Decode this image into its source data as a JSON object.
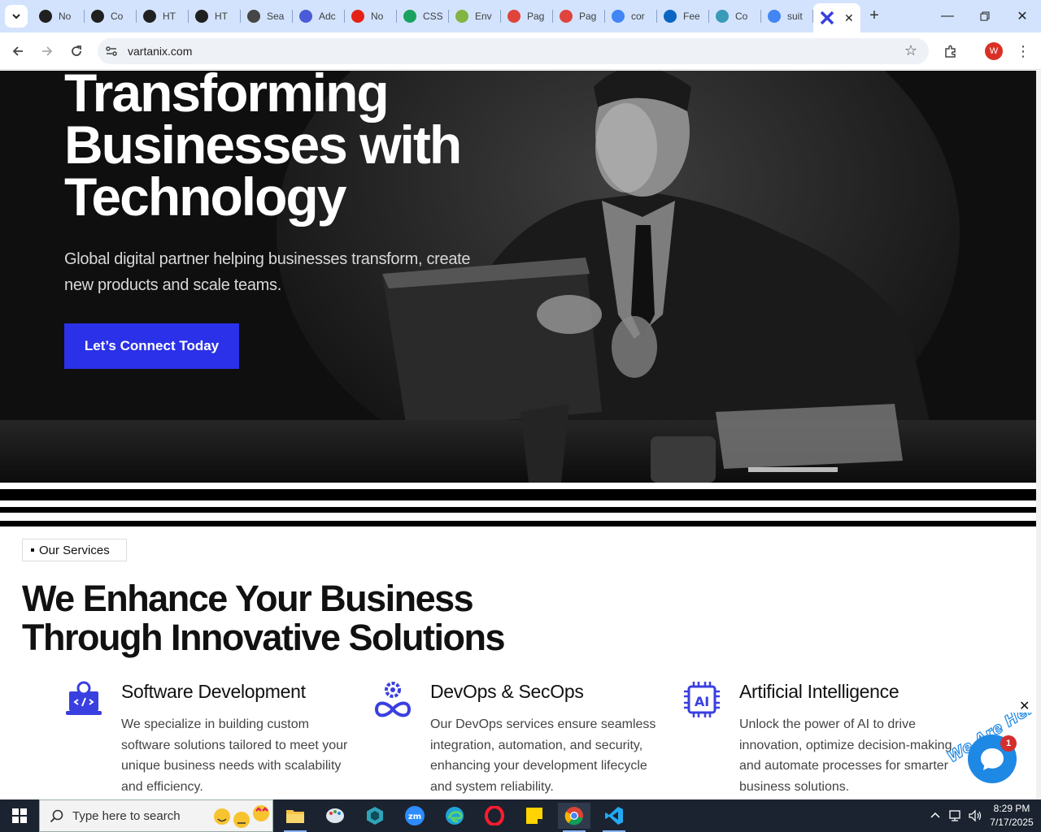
{
  "browser": {
    "tabs": [
      {
        "label": "No",
        "icon": "openai-icon",
        "color": "#202020"
      },
      {
        "label": "Co",
        "icon": "openai-icon",
        "color": "#202020"
      },
      {
        "label": "HT",
        "icon": "openai-icon",
        "color": "#202020"
      },
      {
        "label": "HT",
        "icon": "openai-icon",
        "color": "#202020"
      },
      {
        "label": "Sea",
        "icon": "wordpress-icon",
        "color": "#464646"
      },
      {
        "label": "Adc",
        "icon": "ads-icon",
        "color": "#4a5bd8"
      },
      {
        "label": "No",
        "icon": "youtube-icon",
        "color": "#e62117"
      },
      {
        "label": "CSS",
        "icon": "w-icon",
        "color": "#1aa260"
      },
      {
        "label": "Env",
        "icon": "envato-icon",
        "color": "#82b541"
      },
      {
        "label": "Pag",
        "icon": "diamond-icon",
        "color": "#e0443c"
      },
      {
        "label": "Pag",
        "icon": "diamond-icon",
        "color": "#e0443c"
      },
      {
        "label": "cor",
        "icon": "google-icon",
        "color": "#4285f4"
      },
      {
        "label": "Fee",
        "icon": "linkedin-icon",
        "color": "#0a66c2"
      },
      {
        "label": "Co",
        "icon": "hex-icon",
        "color": "#3a9bb8"
      },
      {
        "label": "suit",
        "icon": "google-icon",
        "color": "#4285f4"
      }
    ],
    "active_tab_icon": "vartanix-icon",
    "url": "vartanix.com",
    "profile_initial": "W"
  },
  "hero": {
    "title": "Transforming Businesses with Technology",
    "subtitle": "Global digital partner helping businesses transform, create new products and scale teams.",
    "cta_label": "Let’s Connect Today",
    "cta_color": "#2b31e8"
  },
  "services": {
    "tag": "Our Services",
    "heading": "We Enhance Your Business Through Innovative Solutions",
    "items": [
      {
        "title": "Software Development",
        "desc": "We specialize in building custom software solutions tailored to meet your unique business needs with scalability and efficiency.",
        "icon": "software-dev-icon"
      },
      {
        "title": "DevOps & SecOps",
        "desc": "Our DevOps services ensure seamless integration, automation, and security, enhancing your development lifecycle and system reliability.",
        "icon": "devops-icon"
      },
      {
        "title": "Artificial Intelligence",
        "desc": "Unlock the power of AI to drive innovation, optimize decision-making, and automate processes for smarter business solutions.",
        "icon": "ai-chip-icon"
      }
    ],
    "accent": "#3a3fe0"
  },
  "chat": {
    "label": "We Are Here!",
    "badge": "1"
  },
  "taskbar": {
    "search_placeholder": "Type here to search",
    "time": "8:29 PM",
    "date": "7/17/2025"
  }
}
